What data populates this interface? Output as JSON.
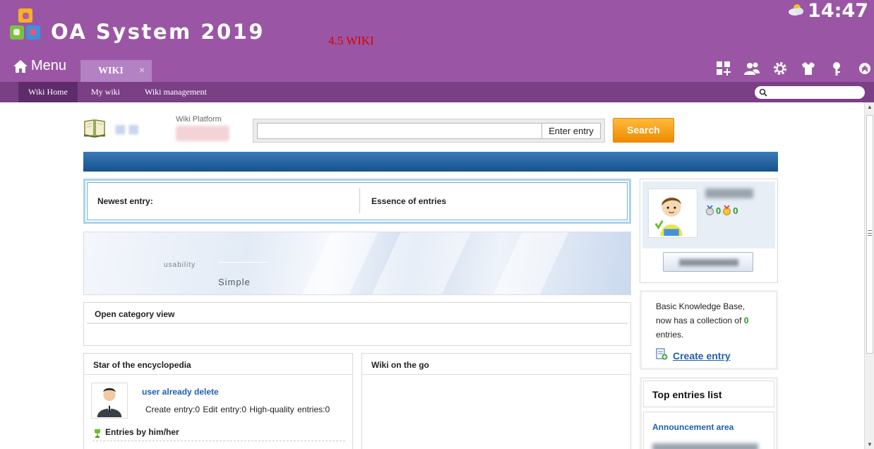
{
  "header": {
    "app_title": "OA System 2019",
    "wiki_version": "4.5 WIKI",
    "clock": "14:47",
    "menu_label": "Menu",
    "tab_label": "WIKI",
    "tab_close": "×",
    "icons": [
      "apps-add-icon",
      "user-group-icon",
      "settings-gear-icon",
      "shirt-icon",
      "key-icon",
      "collapse-up-icon"
    ],
    "brand_color": "#9a56a4"
  },
  "subnav": {
    "items": [
      "Wiki Home",
      "My wiki",
      "Wiki management"
    ],
    "active_index": 0,
    "search_placeholder": ""
  },
  "wiki_header": {
    "platform_label": "Wiki Platform",
    "search_value": "",
    "search_hint": "Enter entry",
    "search_button": "Search"
  },
  "main": {
    "newest_label": "Newest entry:",
    "essence_label": "Essence of entries",
    "banner_word1": "usability",
    "banner_word2": "Simple",
    "category_title": "Open category view",
    "star_title": "Star of the encyclopedia",
    "star_user": "user already delete",
    "star_stats": "Create entry:0   Edit entry:0   High-quality entries:0",
    "star_entries_label": "Entries by him/her",
    "go_title": "Wiki on the go"
  },
  "sidebar": {
    "medal1_count": "0",
    "medal2_count": "0",
    "kb_text_before": "Basic Knowledge Base, now has a collection of ",
    "kb_count": "0",
    "kb_text_after": " entries.",
    "create_entry": "Create entry",
    "top_entries_title": "Top entries list",
    "announcement_label": "Announcement area"
  }
}
